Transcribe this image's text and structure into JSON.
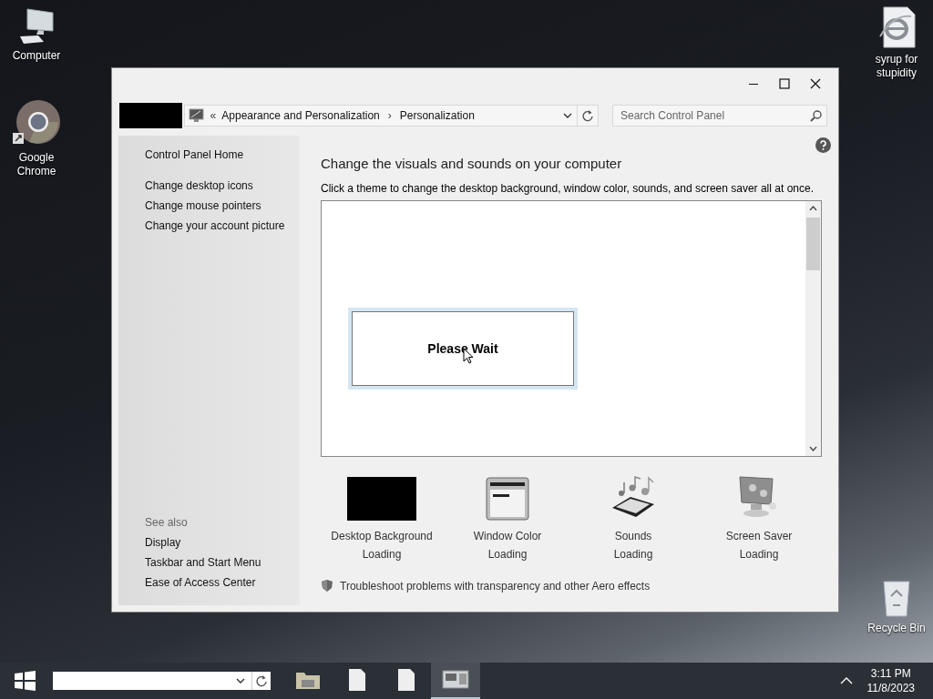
{
  "desktop_icons": [
    {
      "kind": "computer",
      "label": "Computer"
    },
    {
      "kind": "chrome",
      "label": "Google Chrome"
    },
    {
      "kind": "ie-file",
      "label": "syrup for stupidity"
    },
    {
      "kind": "recycle",
      "label": "Recycle Bin"
    }
  ],
  "window": {
    "address": {
      "prefix": "«",
      "items": [
        "Appearance and Personalization",
        "Personalization"
      ],
      "separator": "›"
    },
    "search": {
      "placeholder": "Search Control Panel"
    },
    "sidebar": {
      "top_links": [
        "Control Panel Home",
        "Change desktop icons",
        "Change mouse pointers",
        "Change your account picture"
      ],
      "see_also_title": "See also",
      "see_also_links": [
        "Display",
        "Taskbar and Start Menu",
        "Ease of Access Center"
      ]
    },
    "heading": "Change the visuals and sounds on your computer",
    "subheading": "Click a theme to change the desktop background, window color, sounds, and screen saver all at once.",
    "dialog": {
      "text": "Please Wait"
    },
    "settings": [
      {
        "kind": "background",
        "label": "Desktop Background",
        "status": "Loading"
      },
      {
        "kind": "window-color",
        "label": "Window Color",
        "status": "Loading"
      },
      {
        "kind": "sounds",
        "label": "Sounds",
        "status": "Loading"
      },
      {
        "kind": "screensaver",
        "label": "Screen Saver",
        "status": "Loading"
      }
    ],
    "troubleshoot_link": "Troubleshoot problems with transparency and other Aero effects"
  },
  "taskbar": {
    "apps": [
      {
        "kind": "folder",
        "selected": false
      },
      {
        "kind": "document",
        "selected": false
      },
      {
        "kind": "document",
        "selected": false
      },
      {
        "kind": "control-panel",
        "selected": true
      }
    ],
    "time": "3:11 PM",
    "date": "11/8/2023"
  }
}
